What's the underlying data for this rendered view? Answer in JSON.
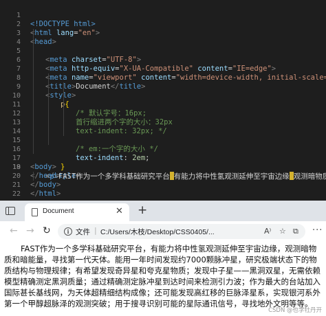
{
  "editor": {
    "lines": [
      {
        "n": "1",
        "t": "<!DOCTYPE html>"
      },
      {
        "n": "2",
        "t": "<html lang=\"en\">"
      },
      {
        "n": "3",
        "t": "<head>"
      },
      {
        "n": "4",
        "t": "<meta charset=\"UTF-8\">"
      },
      {
        "n": "5",
        "t": "<meta http-equiv=\"X-UA-Compatible\" content=\"IE=edge\">"
      },
      {
        "n": "6",
        "t": "<meta name=\"viewport\" content=\"width=device-width, initial-scale=1.0\">"
      },
      {
        "n": "7",
        "t": "<title>Document</title>"
      },
      {
        "n": "8",
        "t": "<style>"
      },
      {
        "n": "9",
        "t": "p{"
      },
      {
        "n": "10",
        "t": "/* 默认字号：16px;"
      },
      {
        "n": "11",
        "t": "首行缩进两个字的大小：32px"
      },
      {
        "n": "12",
        "t": "text-indent: 32px; */"
      },
      {
        "n": "13",
        "t": ""
      },
      {
        "n": "14",
        "t": "/* em:一个字的大小 */"
      },
      {
        "n": "15",
        "t": "text-indent: 2em;"
      },
      {
        "n": "16",
        "t": "}"
      },
      {
        "n": "17",
        "t": "</style>"
      },
      {
        "n": "18",
        "t": "</head>"
      },
      {
        "n": "19",
        "t": "<body>"
      },
      {
        "n": "20",
        "t": "<p>FAST作为一个多学科基础研究平台,有能力将中性氢观测延伸至宇宙边缘,观测暗物质和暗能"
      },
      {
        "n": "21",
        "t": "</body>"
      },
      {
        "n": "22",
        "t": "</html>"
      }
    ],
    "tokens": {
      "doctype": "<!DOCTYPE html>",
      "lang_attr": "lang",
      "lang_val": "\"en\"",
      "charset_attr": "charset",
      "charset_val": "\"UTF-8\"",
      "httpequiv_attr": "http-equiv",
      "httpequiv_val": "\"X-UA-Compatible\"",
      "content_attr": "content",
      "ie_val": "\"IE=edge\"",
      "name_attr": "name",
      "viewport_val": "\"viewport\"",
      "vp_content_val": "\"width=device-width, initial-scale=1.0\"",
      "title_text": "Document",
      "selector": "p",
      "c10": "/* 默认字号：16px;",
      "c11": "首行缩进两个字的大小：32px",
      "c12": "text-indent: 32px; */",
      "c14": "/* em:一个字的大小 */",
      "prop15": "text-indent",
      "val15": "2em",
      "p_text_a": "FAST作为一个多学科基础研究平台",
      "p_text_b": "有能力将中性氢观测延伸至宇宙边缘",
      "p_text_c": "观测暗物质和暗能"
    }
  },
  "browser": {
    "tab_title": "Document",
    "tab_close": "✕",
    "new_tab": "+",
    "nav_back": "←",
    "nav_forward": "→",
    "nav_refresh": "↻",
    "info_glyph": "i",
    "scheme_label": "文件",
    "addr_sep": "|",
    "url": "C:/Users/木枝/Desktop/CSS0405/...",
    "more": "···",
    "paragraph": "FAST作为一个多学科基础研究平台，有能力将中性氢观测延伸至宇宙边缘，观测暗物质和暗能量，寻找第一代天体。能用一年时间发现约7000颗脉冲星，研究极端状态下的物质结构与物理规律；有希望发现奇异星和夸克星物质；发现中子星——黑洞双星，无需依赖模型精确测定黑洞质量；通过精确测定脉冲星到达时间来检测引力波；作为最大的台站加入国际甚长基线网，为天体超精细结构成像；还可能发现高红移的巨脉泽星系，实现银河系外第一个甲醇超脉泽的观测突破；用于搜寻识别可能的星际通讯信号，寻找地外文明等等。",
    "watermark": "CSDN @也学牡丹开"
  }
}
